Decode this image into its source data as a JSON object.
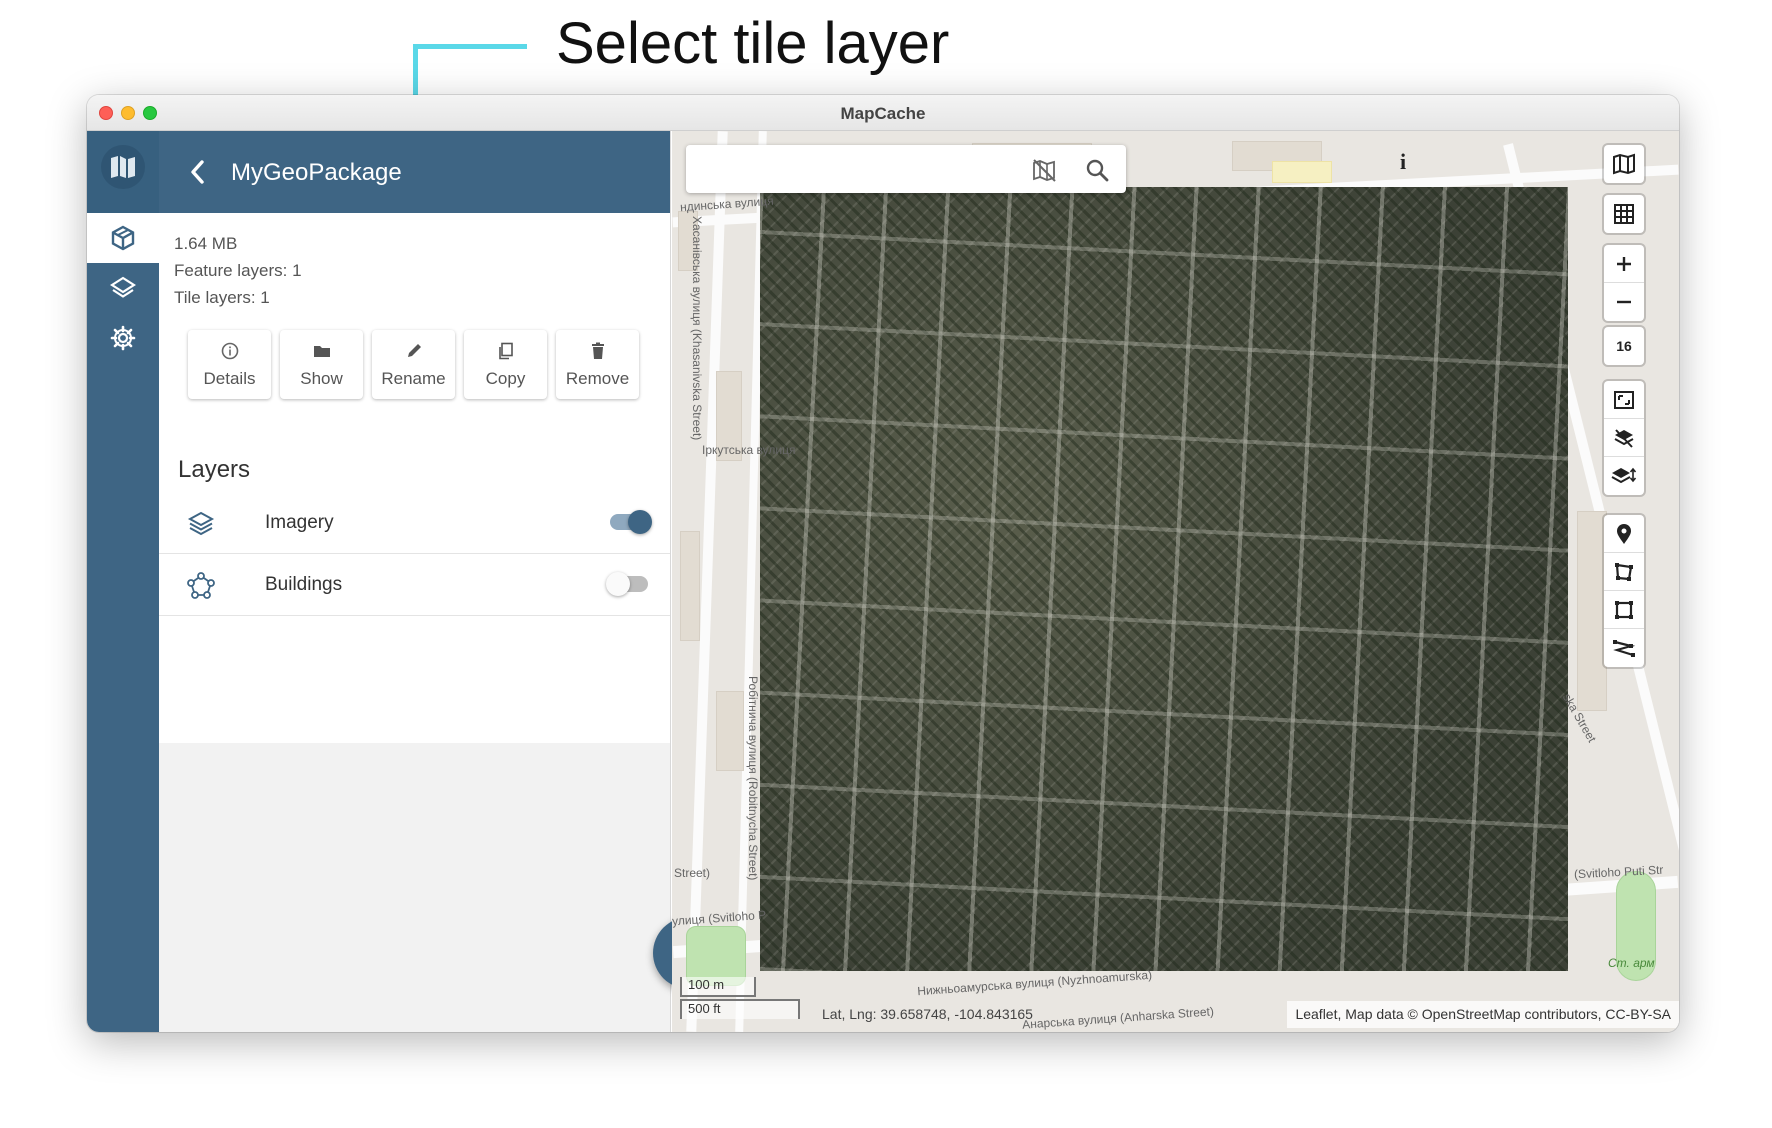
{
  "annotation": {
    "title": "Select tile layer"
  },
  "window": {
    "title": "MapCache"
  },
  "rail": {
    "logo_icon": "mapcache-logo-icon",
    "items": [
      {
        "name": "geopackage-icon",
        "selected": true
      },
      {
        "name": "layers-icon",
        "selected": false
      },
      {
        "name": "settings-gear-icon",
        "selected": false
      }
    ]
  },
  "panel": {
    "back_icon": "chevron-left-icon",
    "title": "MyGeoPackage",
    "size": "1.64 MB",
    "feature_layers": "Feature layers: 1",
    "tile_layers": "Tile layers: 1",
    "actions": [
      {
        "label": "Details",
        "icon": "info-circle-icon"
      },
      {
        "label": "Show",
        "icon": "folder-icon"
      },
      {
        "label": "Rename",
        "icon": "pencil-icon"
      },
      {
        "label": "Copy",
        "icon": "copy-icon"
      },
      {
        "label": "Remove",
        "icon": "trash-icon"
      }
    ],
    "layers_heading": "Layers",
    "layers": [
      {
        "label": "Imagery",
        "icon": "tile-layers-icon",
        "enabled": true,
        "highlighted": true
      },
      {
        "label": "Buildings",
        "icon": "feature-polygon-icon",
        "enabled": false,
        "highlighted": false
      }
    ],
    "fab_icon": "add-layer-icon"
  },
  "map": {
    "search": {
      "value": "",
      "placeholder": ""
    },
    "info_glyph": "i",
    "zoom_level": "16",
    "controls": [
      "basemap-icon",
      "grid-icon",
      "zoom-in-icon",
      "zoom-out-icon",
      "zoom-level",
      "fit-bounds-icon",
      "clear-layers-icon",
      "layer-order-icon",
      "marker-icon",
      "polygon-icon",
      "rectangle-icon",
      "polyline-icon"
    ],
    "scale_metric": "100 m",
    "scale_imperial": "500 ft",
    "latlng": "Lat, Lng: 39.658748, -104.843165",
    "attribution": "Leaflet, Map data © OpenStreetMap contributors, CC-BY-SA",
    "street_labels": [
      "Хасанівська вулиця (Khasanivska Street)",
      "Іркутська вулиця",
      "Робітнича вулиця (Robitnycha Street)",
      "Нижньоамурська вулиця (Nyzhnoamurska)",
      "Анарська вулиця (Anharska Street)",
      "(Svitloho Puti Str",
      "улиця (Svitloho P",
      "Ст. арм",
      "Street)",
      "ндинська вулиця",
      "ska Street"
    ],
    "colors": {
      "accent": "#3e6584",
      "highlight": "#5ad8e8",
      "toggle_on": "#3e6584"
    }
  }
}
